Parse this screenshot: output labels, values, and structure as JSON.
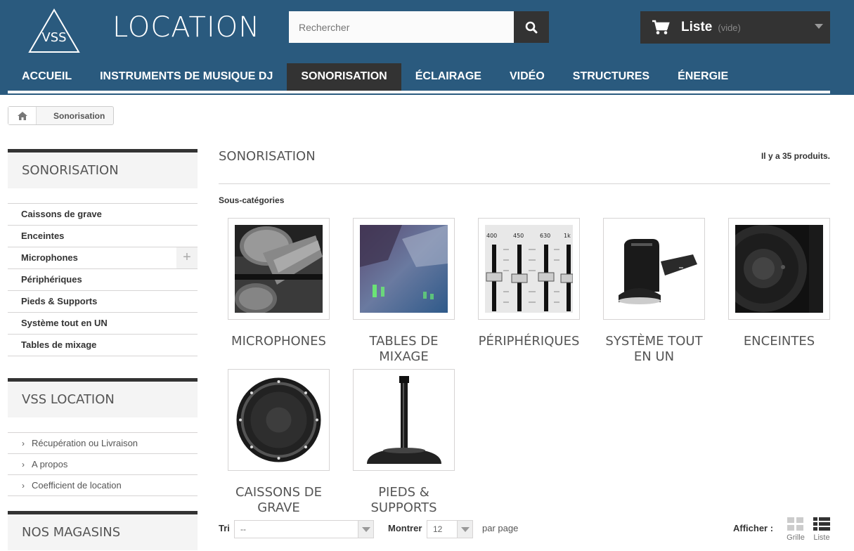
{
  "header": {
    "logo_text": "VSS",
    "brand": "LOCATION",
    "search_placeholder": "Rechercher",
    "cart_title": "Liste",
    "cart_status": "(vide)"
  },
  "nav": [
    {
      "label": "ACCUEIL",
      "active": false
    },
    {
      "label": "INSTRUMENTS DE MUSIQUE DJ",
      "active": false
    },
    {
      "label": "SONORISATION",
      "active": true
    },
    {
      "label": "ÉCLAIRAGE",
      "active": false
    },
    {
      "label": "VIDÉO",
      "active": false
    },
    {
      "label": "STRUCTURES",
      "active": false
    },
    {
      "label": "ÉNERGIE",
      "active": false
    }
  ],
  "breadcrumb": {
    "current": "Sonorisation"
  },
  "sidebar": {
    "categories_title": "SONORISATION",
    "categories": [
      "Caissons de grave",
      "Enceintes",
      "Microphones",
      "Périphériques",
      "Pieds & Supports",
      "Système tout en UN",
      "Tables de mixage"
    ],
    "info_title": "VSS LOCATION",
    "info_links": [
      "Récupération ou Livraison",
      "A propos",
      "Coefficient de location"
    ],
    "stores_title": "NOS MAGASINS"
  },
  "main": {
    "title": "SONORISATION",
    "count": "Il y a 35 produits.",
    "subcategories_label": "Sous-catégories",
    "subcategories": [
      {
        "name": "MICROPHONES",
        "icon": "microphone-image"
      },
      {
        "name": "TABLES DE MIXAGE",
        "icon": "mixing-table-image"
      },
      {
        "name": "PÉRIPHÉRIQUES",
        "icon": "equalizer-image"
      },
      {
        "name": "SYSTÈME TOUT EN UN",
        "icon": "portable-speaker-image"
      },
      {
        "name": "ENCEINTES",
        "icon": "speaker-image"
      },
      {
        "name": "CAISSONS DE GRAVE",
        "icon": "subwoofer-image"
      },
      {
        "name": "PIEDS & SUPPORTS",
        "icon": "stand-image"
      }
    ],
    "sort_label": "Tri",
    "sort_value": "--",
    "show_label": "Montrer",
    "show_value": "12",
    "per_page": "par page",
    "display_label": "Afficher :",
    "grid_label": "Grille",
    "list_label": "Liste"
  },
  "colors": {
    "header": "#2a5a7e",
    "dark": "#333333"
  }
}
